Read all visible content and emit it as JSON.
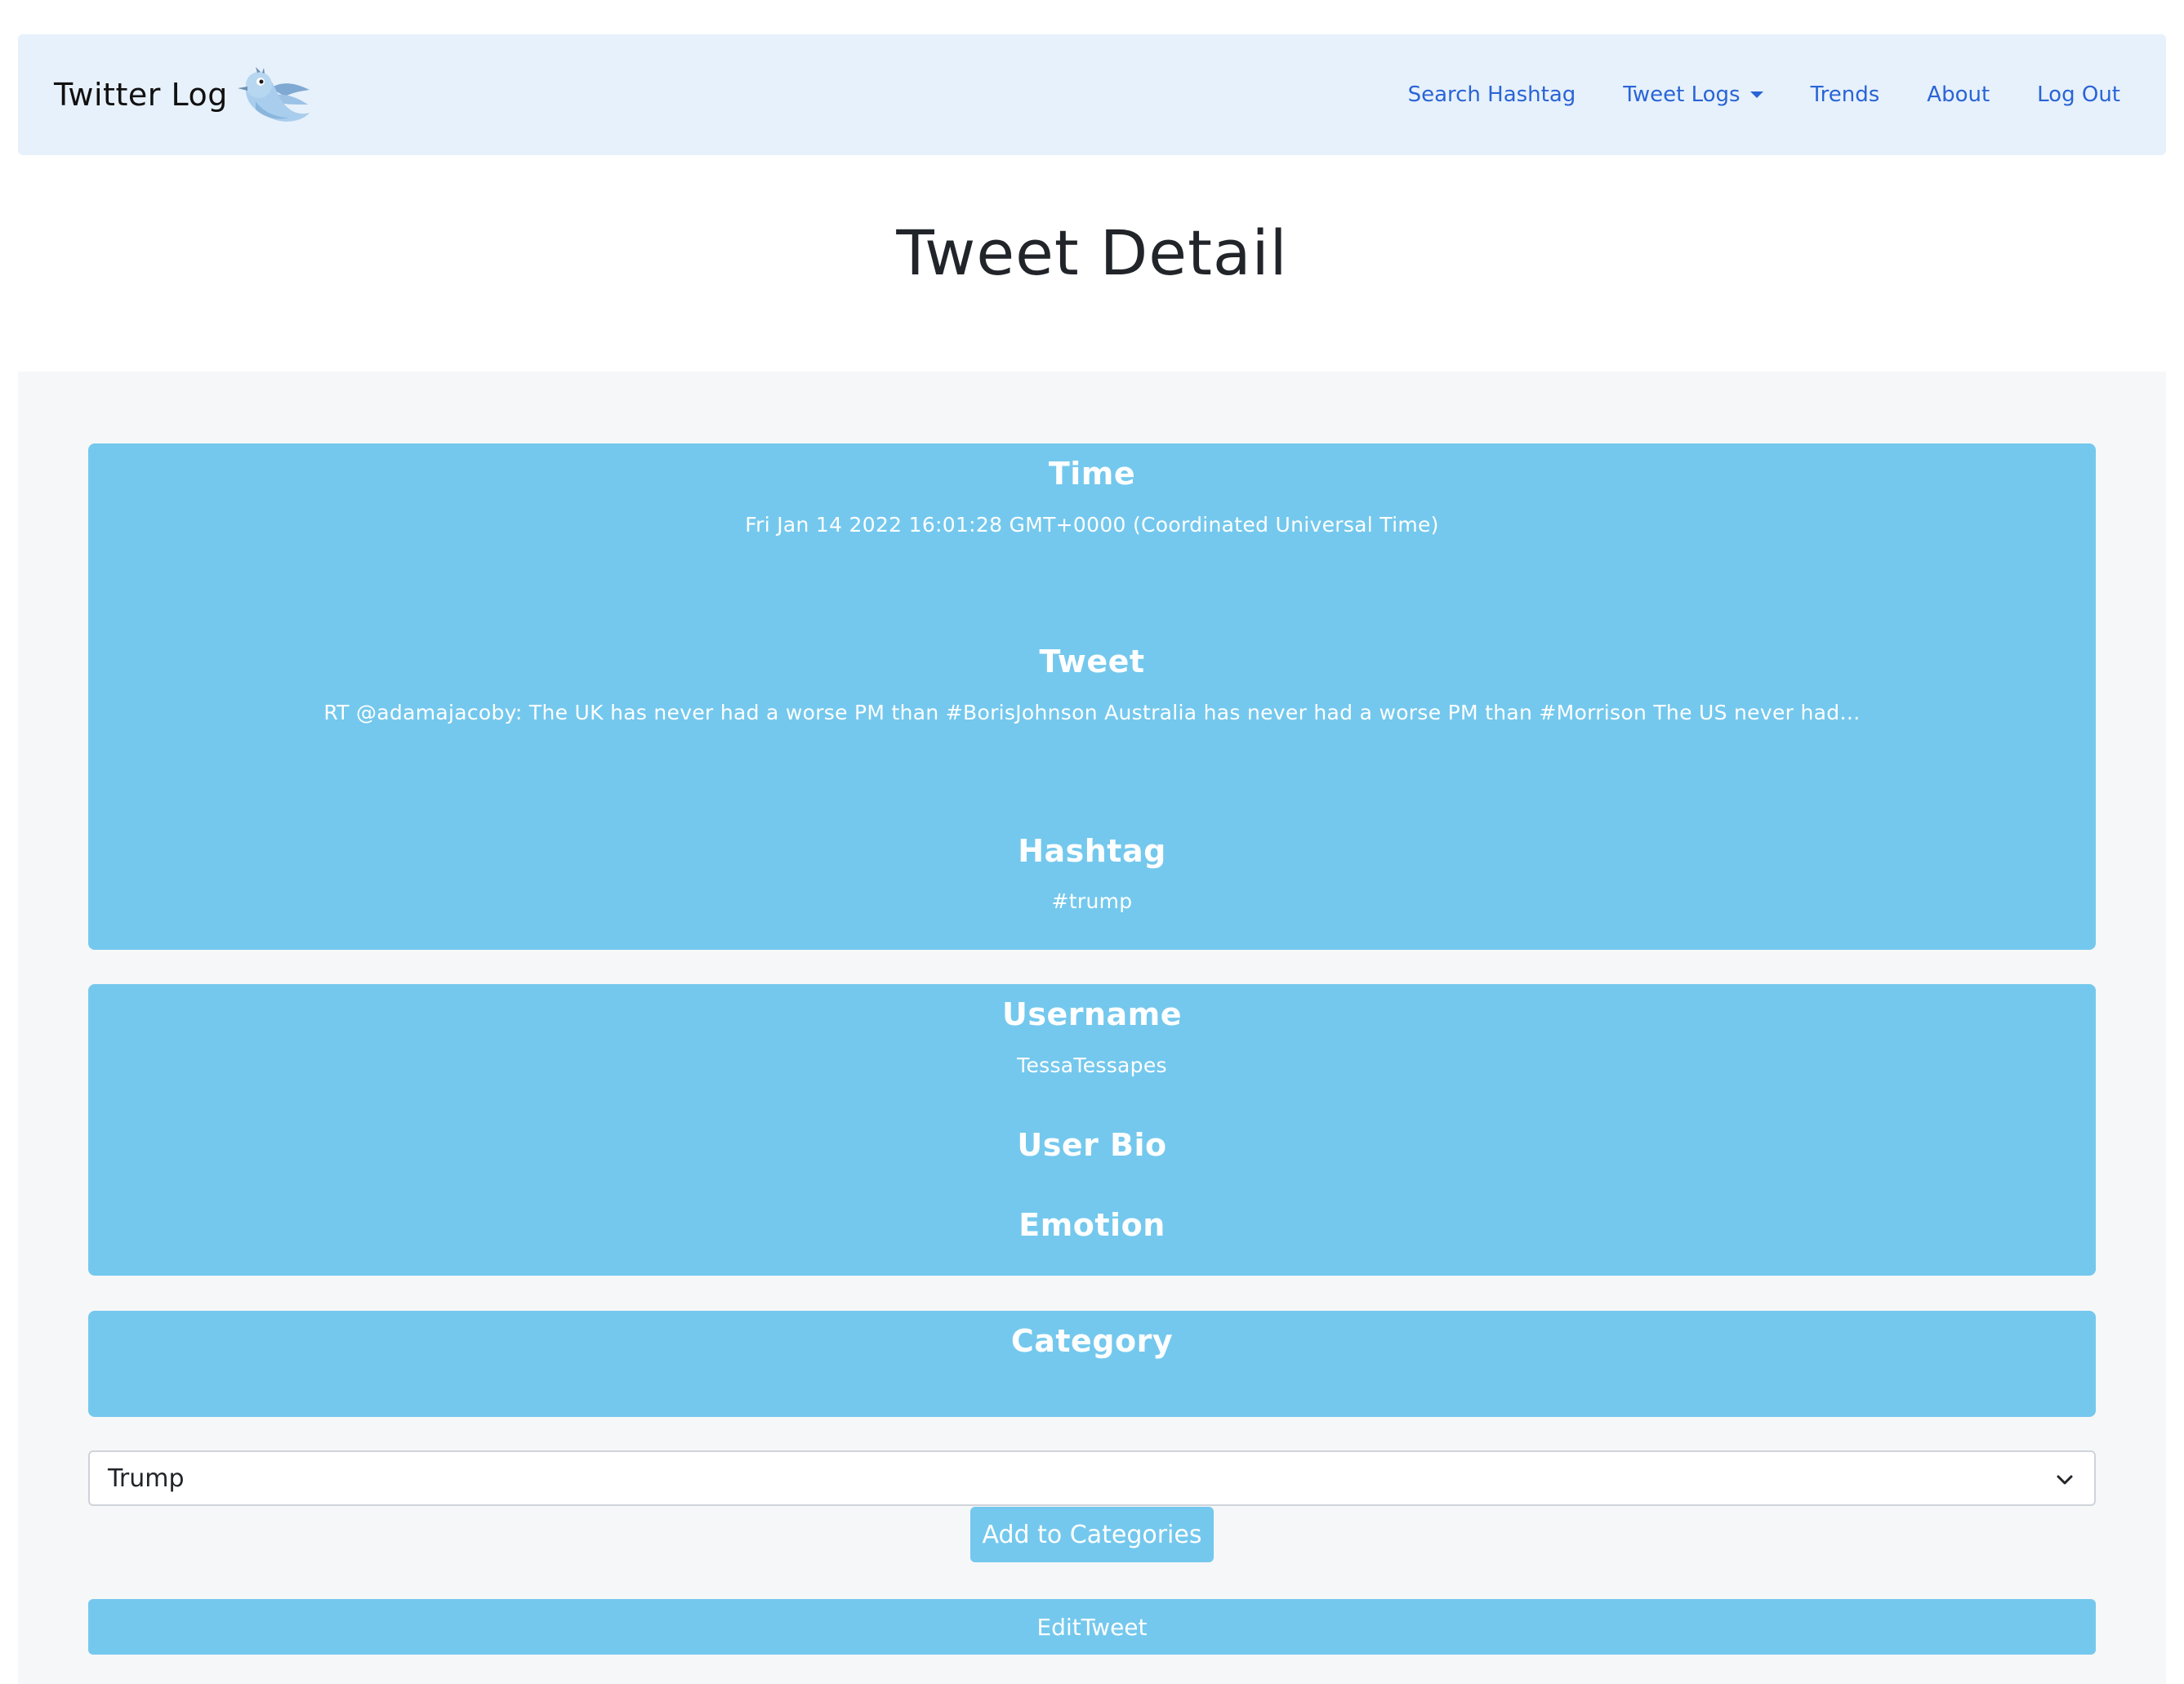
{
  "navbar": {
    "brand": "Twitter Log",
    "links": {
      "search_hashtag": "Search Hashtag",
      "tweet_logs": "Tweet Logs",
      "trends": "Trends",
      "about": "About",
      "log_out": "Log Out"
    }
  },
  "page_title": "Tweet Detail",
  "tweet_card": {
    "time_heading": "Time",
    "time_value": "Fri Jan 14 2022 16:01:28 GMT+0000 (Coordinated Universal Time)",
    "tweet_heading": "Tweet",
    "tweet_value": "RT @adamajacoby: The UK has never had a worse PM than #BorisJohnson Australia has never had a worse PM than #Morrison The US never had…",
    "hashtag_heading": "Hashtag",
    "hashtag_value": "#trump"
  },
  "user_card": {
    "username_heading": "Username",
    "username_value": "TessaTessapes",
    "bio_heading": "User Bio",
    "emotion_heading": "Emotion"
  },
  "category_card": {
    "heading": "Category"
  },
  "category_select": {
    "selected": "Trump"
  },
  "buttons": {
    "add_to_categories": "Add to Categories",
    "edit_tweet": "EditTweet"
  },
  "colors": {
    "navbar_bg": "#e7f1fb",
    "nav_link": "#2a64d6",
    "card_bg": "#74c8ed",
    "main_bg": "#f6f7f9"
  },
  "icons": {
    "brand_logo": "bird-icon",
    "dropdown_caret": "caret-down-icon",
    "select_chevron": "chevron-down-icon"
  }
}
